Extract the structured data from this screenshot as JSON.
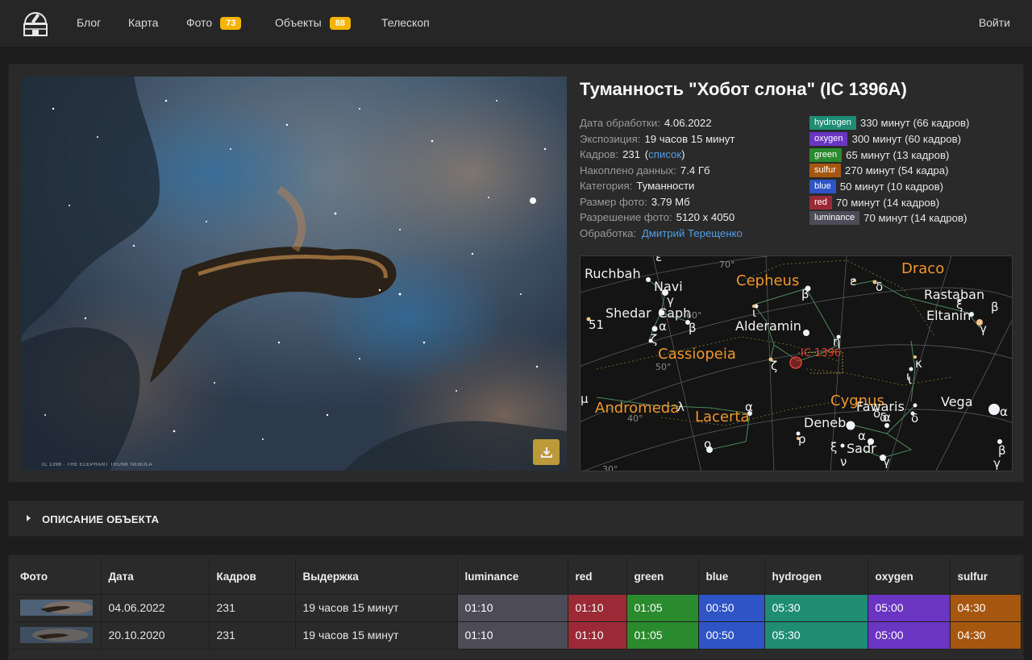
{
  "nav": {
    "items": [
      {
        "label": "Блог"
      },
      {
        "label": "Карта"
      },
      {
        "label": "Фото",
        "badge": "73"
      },
      {
        "label": "Объекты",
        "badge": "88"
      },
      {
        "label": "Телескоп"
      }
    ],
    "login": "Войти",
    "badge_color": "#f6b400"
  },
  "object": {
    "title": "Туманность \"Хобот слона\" (IC 1396A)",
    "photo_caption": "IC 1396 · THE ELEPHANT TRUNK NEBULA",
    "download_icon": "download-icon",
    "info": [
      {
        "key": "Дата обработки:",
        "value": "4.06.2022"
      },
      {
        "key": "Экспозиция:",
        "value": "19 часов 15 минут"
      },
      {
        "key": "Кадров:",
        "value": "231",
        "paren_open": "(",
        "link": "список",
        "paren_close": ")"
      },
      {
        "key": "Накоплено данных:",
        "value": "7.4 Гб"
      },
      {
        "key": "Категория:",
        "value": "Туманности"
      },
      {
        "key": "Размер фото:",
        "value": "3.79 Мб"
      },
      {
        "key": "Разрешение фото:",
        "value": "5120 x 4050"
      },
      {
        "key": "Обработка:",
        "link": "Дмитрий Терещенко"
      }
    ],
    "filters": [
      {
        "name": "hydrogen",
        "text": "330 минут (66 кадров)",
        "color": "#1f8c74"
      },
      {
        "name": "oxygen",
        "text": "300 минут (60 кадров)",
        "color": "#6a35c2"
      },
      {
        "name": "green",
        "text": "65 минут (13 кадров)",
        "color": "#2a8a2e"
      },
      {
        "name": "sulfur",
        "text": "270 минут (54 кадра)",
        "color": "#a6570f"
      },
      {
        "name": "blue",
        "text": "50 минут (10 кадров)",
        "color": "#2e54c6"
      },
      {
        "name": "red",
        "text": "70 минут (14 кадров)",
        "color": "#9b2a36"
      },
      {
        "name": "luminance",
        "text": "70 минут (14 кадров)",
        "color": "#4d4b57"
      }
    ]
  },
  "starmap": {
    "target": "IC 1396",
    "constellations": [
      "Cepheus",
      "Draco",
      "Cassiopeia",
      "Andromeda",
      "Lacerta",
      "Cygnus"
    ],
    "stars": [
      "Ruchbah",
      "Navi",
      "Shedar",
      "Caph",
      "Alderamin",
      "Rastaban",
      "Eltanin",
      "Deneb",
      "Sadr",
      "Fawaris",
      "Vega"
    ],
    "declination_labels": [
      "70°",
      "60°",
      "50°",
      "40°",
      "30°"
    ],
    "greek": [
      "ε",
      "γ",
      "β",
      "α",
      "ζ",
      "η",
      "ι",
      "δ",
      "ε",
      "ξ",
      "β",
      "γ",
      "κ",
      "ι",
      "λ",
      "α",
      "o",
      "ρ",
      "α",
      "ξ",
      "ν",
      "γ",
      "δ",
      "α",
      "β",
      "γ",
      "μ",
      "51",
      "β",
      "δ",
      "α",
      "δ",
      "ι",
      "ζ"
    ]
  },
  "description": {
    "label": "ОПИСАНИЕ ОБЪЕКТА"
  },
  "table": {
    "headers": [
      "Фото",
      "Дата",
      "Кадров",
      "Выдержка",
      "luminance",
      "red",
      "green",
      "blue",
      "hydrogen",
      "oxygen",
      "sulfur"
    ],
    "colors": [
      "#4d4b57",
      "#9b2a36",
      "#2a8a2e",
      "#2e54c6",
      "#1f8c74",
      "#6a35c2",
      "#a6570f"
    ],
    "rows": [
      {
        "date": "04.06.2022",
        "frames": "231",
        "exposure": "19 часов 15 минут",
        "luminance": "01:10",
        "red": "01:10",
        "green": "01:05",
        "blue": "00:50",
        "hydrogen": "05:30",
        "oxygen": "05:00",
        "sulfur": "04:30"
      },
      {
        "date": "20.10.2020",
        "frames": "231",
        "exposure": "19 часов 15 минут",
        "luminance": "01:10",
        "red": "01:10",
        "green": "01:05",
        "blue": "00:50",
        "hydrogen": "05:30",
        "oxygen": "05:00",
        "sulfur": "04:30"
      }
    ]
  }
}
